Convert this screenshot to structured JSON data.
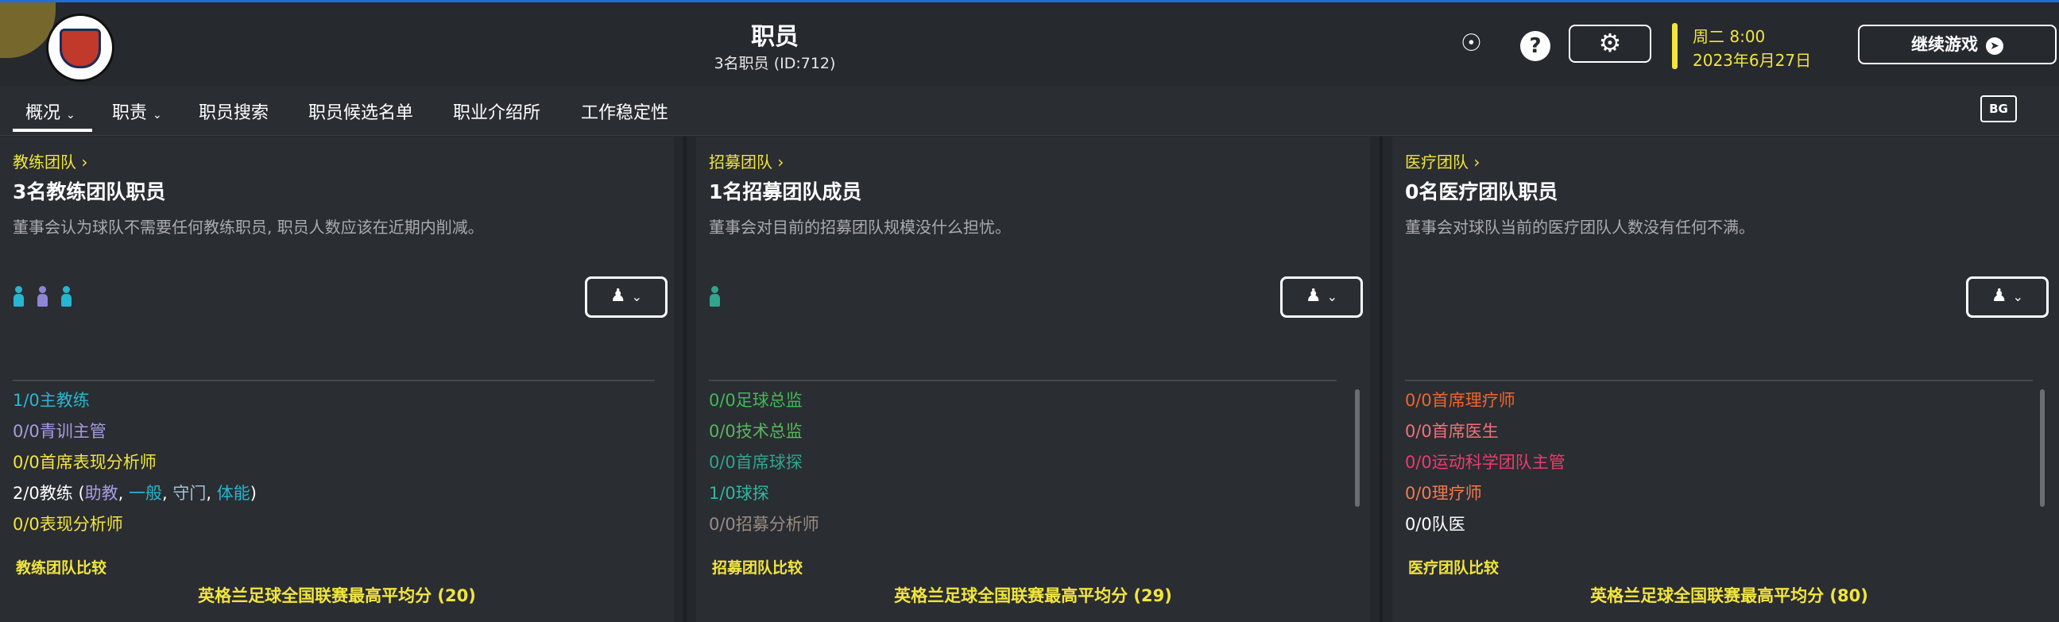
{
  "header": {
    "title": "职员",
    "subtitle": "3名职员 (ID:712)",
    "day_time": "周二 8:00",
    "date": "2023年6月27日",
    "continue_label": "继续游戏",
    "help_label": "?",
    "settings_icon": "gear-icon",
    "continue_icon": "arrow-right-circle-icon"
  },
  "tabs": [
    {
      "label": "概况",
      "has_dropdown": true,
      "active": true
    },
    {
      "label": "职责",
      "has_dropdown": true,
      "active": false
    },
    {
      "label": "职员搜索"
    },
    {
      "label": "职员候选名单"
    },
    {
      "label": "职业介绍所"
    },
    {
      "label": "工作稳定性"
    }
  ],
  "bg_badge": "BG",
  "panels": [
    {
      "link": "教练团队",
      "heading": "3名教练团队职员",
      "description": "董事会认为球队不需要任何教练职员, 职员人数应该在近期内削减。",
      "people_colors": [
        "#27b6cf",
        "#8d86d6",
        "#27b6cf"
      ],
      "roles": [
        {
          "count": "1/0",
          "name": "主教练",
          "color": "#27b6cf"
        },
        {
          "count": "0/0",
          "name": "青训主管",
          "color": "#a99be0"
        },
        {
          "count": "0/0",
          "name": "首席表现分析师",
          "color": "#f2e53d"
        },
        {
          "count": "2/0",
          "name": "教练 (",
          "color": "#ffffff"
        },
        {
          "count": "0/0",
          "name": "表现分析师",
          "color": "#f2e53d"
        }
      ],
      "coach_sub": [
        {
          "label": "助教",
          "color": "#a99be0"
        },
        {
          "label": "一般",
          "color": "#27b6cf"
        },
        {
          "label": "守门",
          "color": "#a0c3d8"
        },
        {
          "label": "体能",
          "color": "#27b6cf"
        }
      ],
      "compare_label": "教练团队比较",
      "compare_value": "英格兰足球全国联赛最高平均分 (20)"
    },
    {
      "link": "招募团队",
      "heading": "1名招募团队成员",
      "description": "董事会对目前的招募团队规模没什么担忧。",
      "people_colors": [
        "#2fa58c"
      ],
      "roles": [
        {
          "count": "0/0",
          "name": "足球总监",
          "color": "#3dbb57"
        },
        {
          "count": "0/0",
          "name": "技术总监",
          "color": "#57b85e"
        },
        {
          "count": "0/0",
          "name": "首席球探",
          "color": "#2fa58c"
        },
        {
          "count": "1/0",
          "name": "球探",
          "color": "#2fb9a0"
        },
        {
          "count": "0/0",
          "name": "招募分析师",
          "color": "#9b8c82"
        }
      ],
      "compare_label": "招募团队比较",
      "compare_value": "英格兰足球全国联赛最高平均分 (29)"
    },
    {
      "link": "医疗团队",
      "heading": "0名医疗团队职员",
      "description": "董事会对球队当前的医疗团队人数没有任何不满。",
      "people_colors": [],
      "roles": [
        {
          "count": "0/0",
          "name": "首席理疗师",
          "color": "#f0642d"
        },
        {
          "count": "0/0",
          "name": "首席医生",
          "color": "#f37078"
        },
        {
          "count": "0/0",
          "name": "运动科学团队主管",
          "color": "#ee3b6b"
        },
        {
          "count": "0/0",
          "name": "理疗师",
          "color": "#f37a4e"
        },
        {
          "count": "0/0",
          "name": "队医",
          "color": "#ffffff"
        }
      ],
      "compare_label": "医疗团队比较",
      "compare_value": "英格兰足球全国联赛最高平均分 (80)"
    }
  ]
}
